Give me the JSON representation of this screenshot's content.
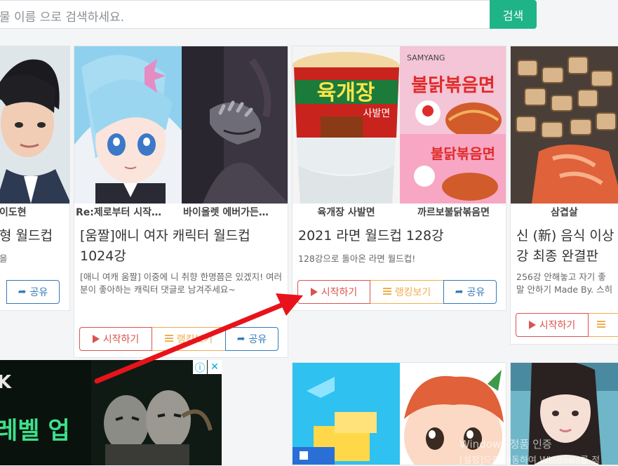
{
  "search": {
    "placeholder": "물 이름 으로 검색하세요.",
    "button_label": "검색"
  },
  "cards": [
    {
      "captions": [
        "이도현"
      ],
      "title_lines": [
        "형 월드컵"
      ],
      "desc": "을",
      "start": "",
      "rank": "",
      "share": "공유"
    },
    {
      "captions": [
        "Re:제로부터 시작…",
        "바이올렛 에버가든…"
      ],
      "title_lines": [
        "[움짤]애니 여자 캐릭터 월드컵",
        "1024강"
      ],
      "desc": "[애니 여캐 움짤] 이중에 니 취향 한명쯤은 있겠지!   여러분이 좋아하는 캐릭터 댓글로 남겨주세요~",
      "start": "시작하기",
      "rank": "랭킹보기",
      "share": "공유"
    },
    {
      "captions": [
        "육개장 사발면",
        "까르보불닭볶음면"
      ],
      "title_lines": [
        "2021 라면 월드컵 128강"
      ],
      "desc": "128강으로 돌아온 라면 월드컵!",
      "start": "시작하기",
      "rank": "랭킹보기",
      "share": "공유"
    },
    {
      "captions": [
        "삼겹살"
      ],
      "title_lines": [
        "신 (新) 음식 이상",
        "강 최종 완결판"
      ],
      "desc": "256강 안해놓고 자기 좋",
      "desc2": "말 안하기 Made By. 스히",
      "start": "시작하기",
      "rank": "",
      "share": ""
    }
  ],
  "images": {
    "ramen_1_text": "육개장",
    "ramen_1_sub": "사발면",
    "ramen_2_text": "불닭볶음면",
    "ramen_2_brand": "SAMYANG",
    "ad_text": "레벨 업",
    "ad_letter": "K"
  },
  "ad": {
    "info_icon": "ⓘ",
    "close_icon": "✕"
  },
  "watermark": {
    "line1": "Windows 정품 인증",
    "line2": "[설정]으로 이동하여 Windows를 정"
  },
  "colors": {
    "accent": "#1fb487",
    "start": "#d9534f",
    "rank": "#f0ad4e",
    "share": "#337ab7",
    "arrow": "#e8131a"
  }
}
